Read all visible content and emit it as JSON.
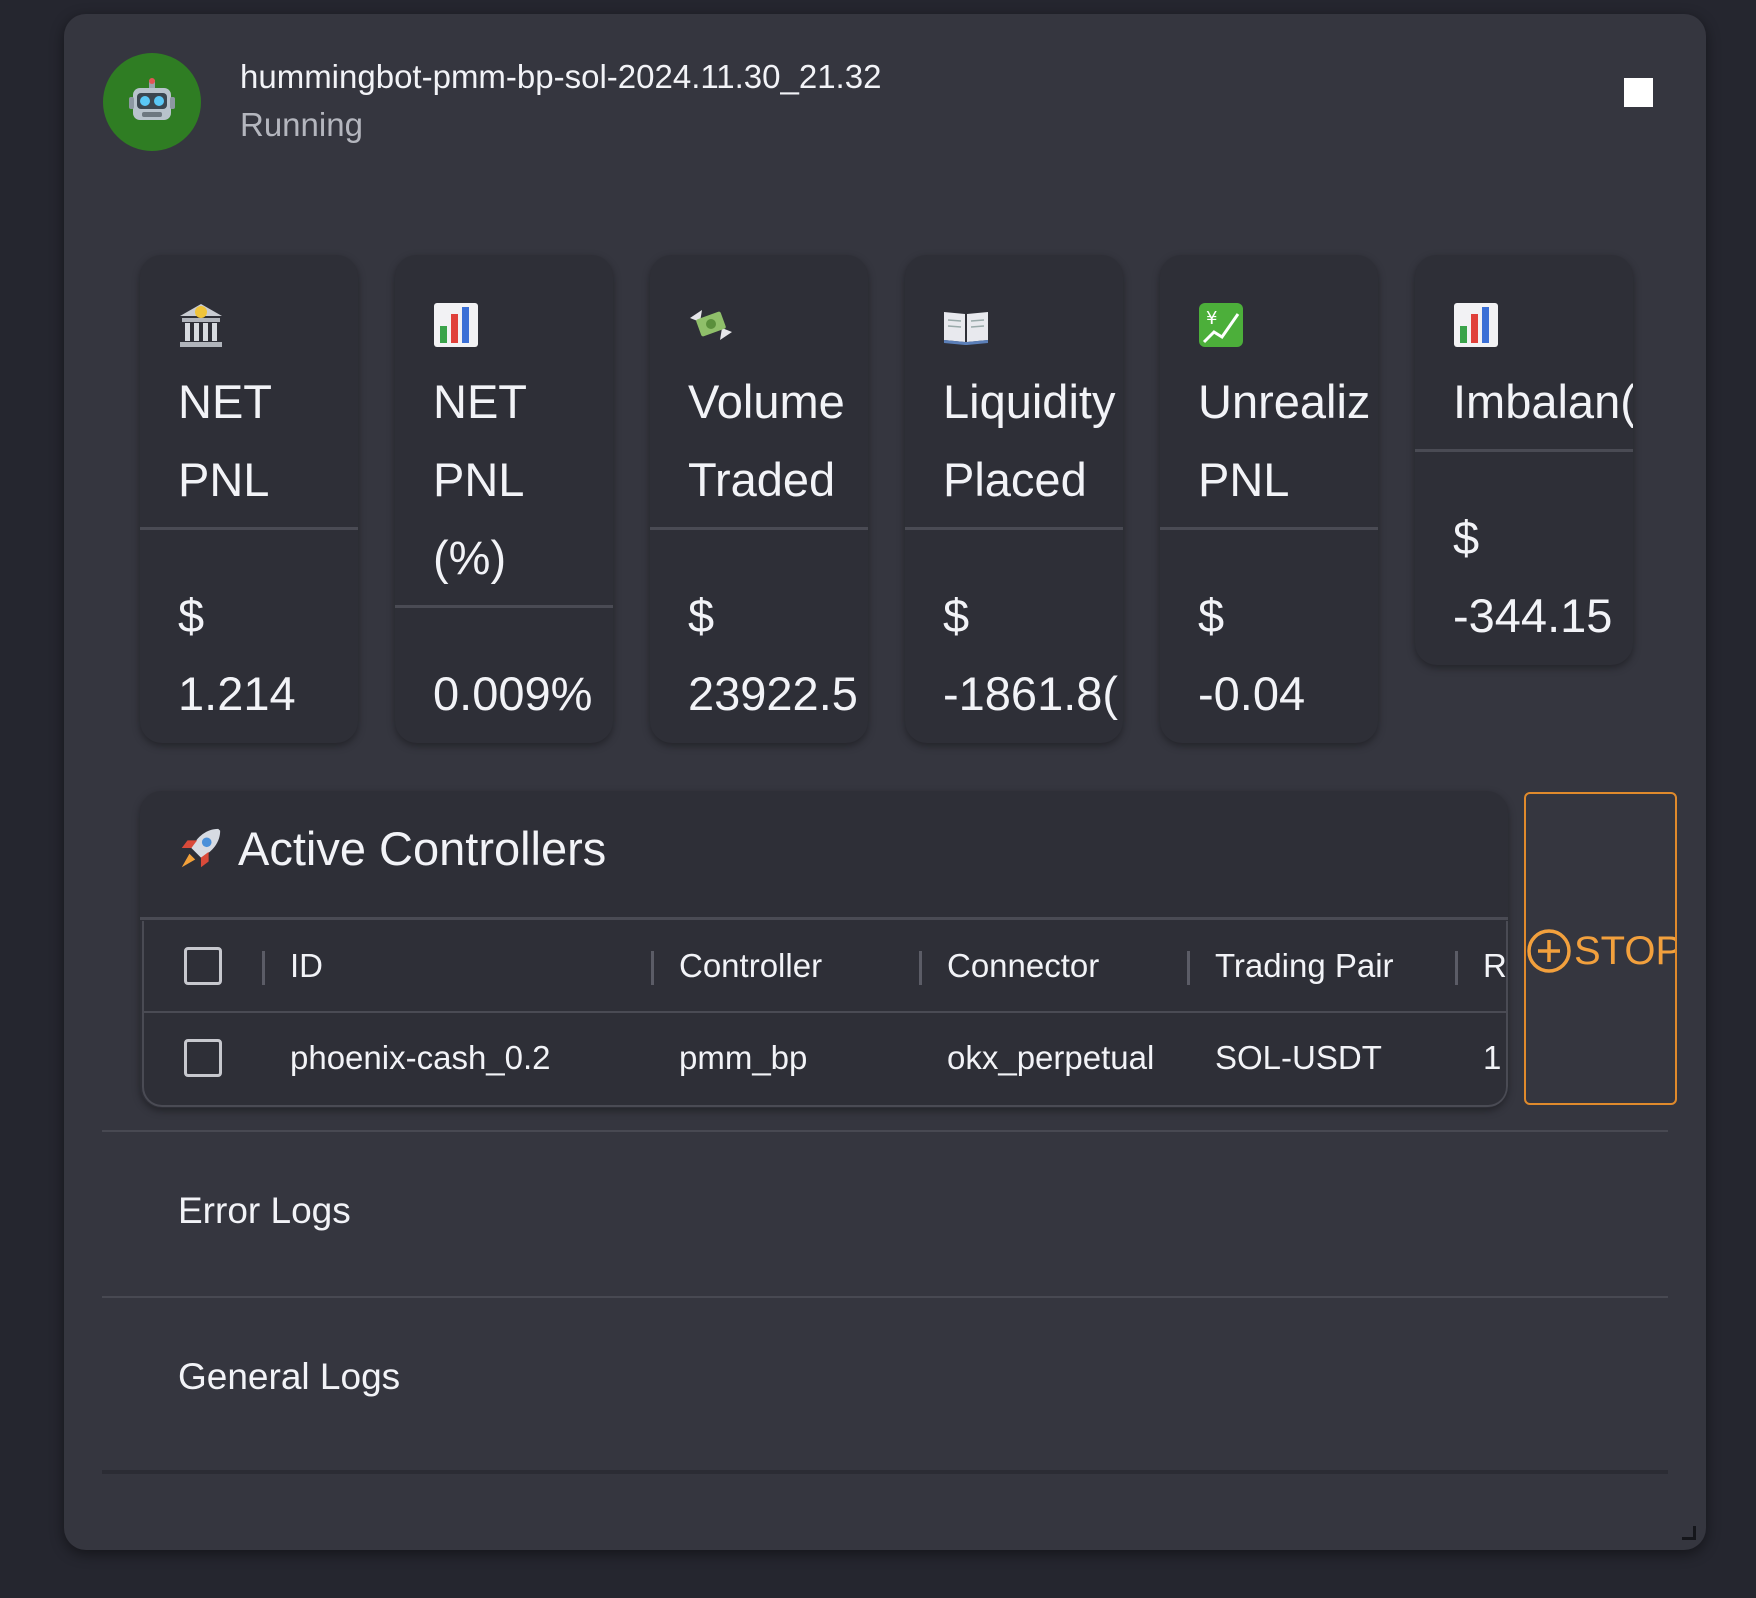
{
  "bot": {
    "name": "hummingbot-pmm-bp-sol-2024.11.30_21.32",
    "status": "Running"
  },
  "metrics": [
    {
      "icon": "bank-icon",
      "label": "NET\nPNL",
      "value": "$\n1.214"
    },
    {
      "icon": "bar-chart-icon",
      "label": "NET\nPNL\n(%)",
      "value": "0.009%"
    },
    {
      "icon": "money-wings-icon",
      "label": "Volume\nTraded",
      "value": "$\n23922.5"
    },
    {
      "icon": "open-book-icon",
      "label": "Liquidity\nPlaced",
      "value": "$\n-1861.8("
    },
    {
      "icon": "chart-yen-icon",
      "label": "Unrealiz\nPNL",
      "value": "$\n-0.04"
    },
    {
      "icon": "bar-chart-icon",
      "label": "Imbalan(",
      "value": "$\n-344.15"
    }
  ],
  "controllers": {
    "title": "Active Controllers",
    "columns": [
      "ID",
      "Controller",
      "Connector",
      "Trading Pair",
      "R"
    ],
    "rows": [
      [
        "phoenix-cash_0.2",
        "pmm_bp",
        "okx_perpetual",
        "SOL-USDT",
        "1"
      ]
    ],
    "stop_label": "STOP"
  },
  "logs": {
    "error_label": "Error Logs",
    "general_label": "General Logs"
  },
  "colors": {
    "accent": "#e08a2c",
    "avatar": "#2f7d23",
    "card": "#35363f",
    "panel": "#2e2f37"
  }
}
